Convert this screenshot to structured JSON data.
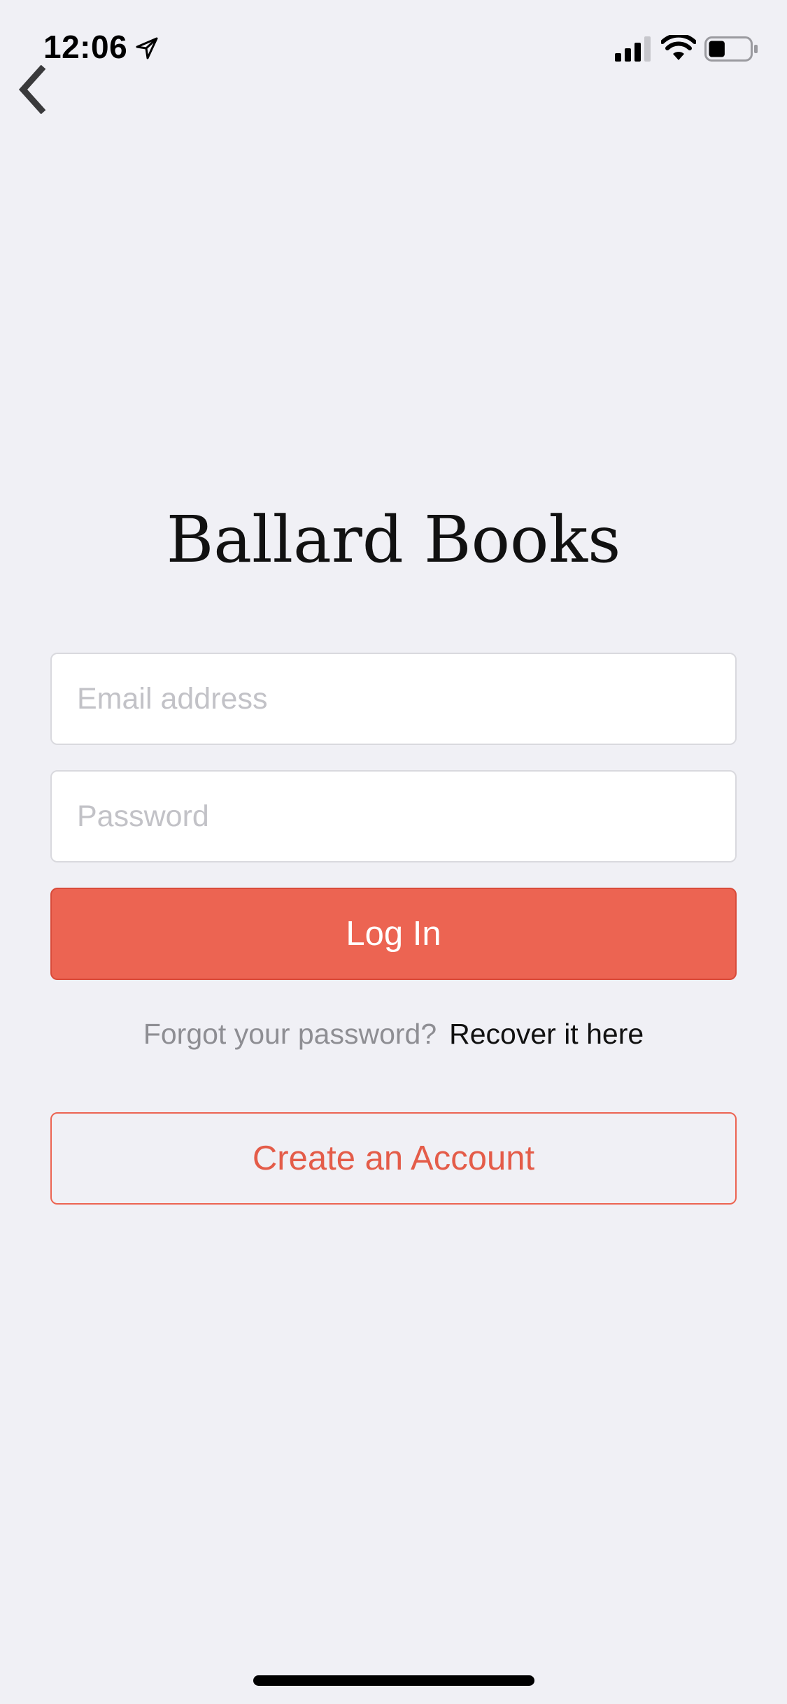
{
  "status_bar": {
    "time": "12:06",
    "location_icon": "location-arrow-icon",
    "signal_icon": "cellular-signal-icon",
    "wifi_icon": "wifi-icon",
    "battery_icon": "battery-icon",
    "battery_level": 0.4
  },
  "nav": {
    "back_icon": "chevron-left-icon"
  },
  "app_title": "Ballard Books",
  "form": {
    "email_value": "",
    "email_placeholder": "Email address",
    "password_value": "",
    "password_placeholder": "Password",
    "login_label": "Log In"
  },
  "forgot": {
    "prompt": "Forgot your password?",
    "link": "Recover it here"
  },
  "create_account_label": "Create an Account",
  "colors": {
    "background": "#f0f0f5",
    "accent": "#ec6452",
    "muted_text": "#8e8e93",
    "placeholder": "#c2c2c7"
  }
}
